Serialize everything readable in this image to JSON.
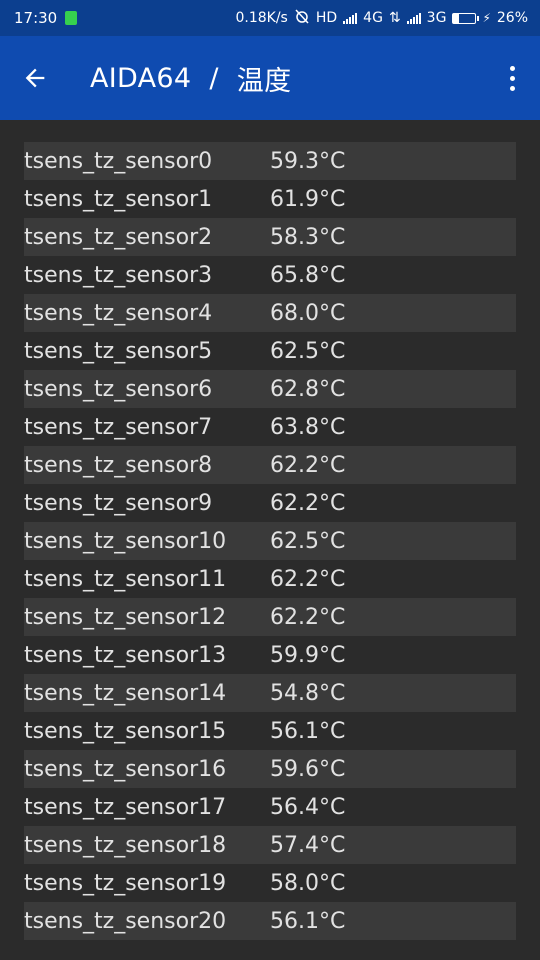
{
  "status_bar": {
    "time": "17:30",
    "net_speed": "0.18K/s",
    "hd": "HD",
    "net1": "4G",
    "net2": "3G",
    "battery": "26%",
    "battery_level": 0.26
  },
  "app_bar": {
    "app_name": "AIDA64",
    "separator": "/",
    "page_title": "温度"
  },
  "sensors": [
    {
      "name": "tsens_tz_sensor0",
      "value": "59.3°C"
    },
    {
      "name": "tsens_tz_sensor1",
      "value": "61.9°C"
    },
    {
      "name": "tsens_tz_sensor2",
      "value": "58.3°C"
    },
    {
      "name": "tsens_tz_sensor3",
      "value": "65.8°C"
    },
    {
      "name": "tsens_tz_sensor4",
      "value": "68.0°C"
    },
    {
      "name": "tsens_tz_sensor5",
      "value": "62.5°C"
    },
    {
      "name": "tsens_tz_sensor6",
      "value": "62.8°C"
    },
    {
      "name": "tsens_tz_sensor7",
      "value": "63.8°C"
    },
    {
      "name": "tsens_tz_sensor8",
      "value": "62.2°C"
    },
    {
      "name": "tsens_tz_sensor9",
      "value": "62.2°C"
    },
    {
      "name": "tsens_tz_sensor10",
      "value": "62.5°C"
    },
    {
      "name": "tsens_tz_sensor11",
      "value": "62.2°C"
    },
    {
      "name": "tsens_tz_sensor12",
      "value": "62.2°C"
    },
    {
      "name": "tsens_tz_sensor13",
      "value": "59.9°C"
    },
    {
      "name": "tsens_tz_sensor14",
      "value": "54.8°C"
    },
    {
      "name": "tsens_tz_sensor15",
      "value": "56.1°C"
    },
    {
      "name": "tsens_tz_sensor16",
      "value": "59.6°C"
    },
    {
      "name": "tsens_tz_sensor17",
      "value": "56.4°C"
    },
    {
      "name": "tsens_tz_sensor18",
      "value": "57.4°C"
    },
    {
      "name": "tsens_tz_sensor19",
      "value": "58.0°C"
    },
    {
      "name": "tsens_tz_sensor20",
      "value": "56.1°C"
    }
  ]
}
